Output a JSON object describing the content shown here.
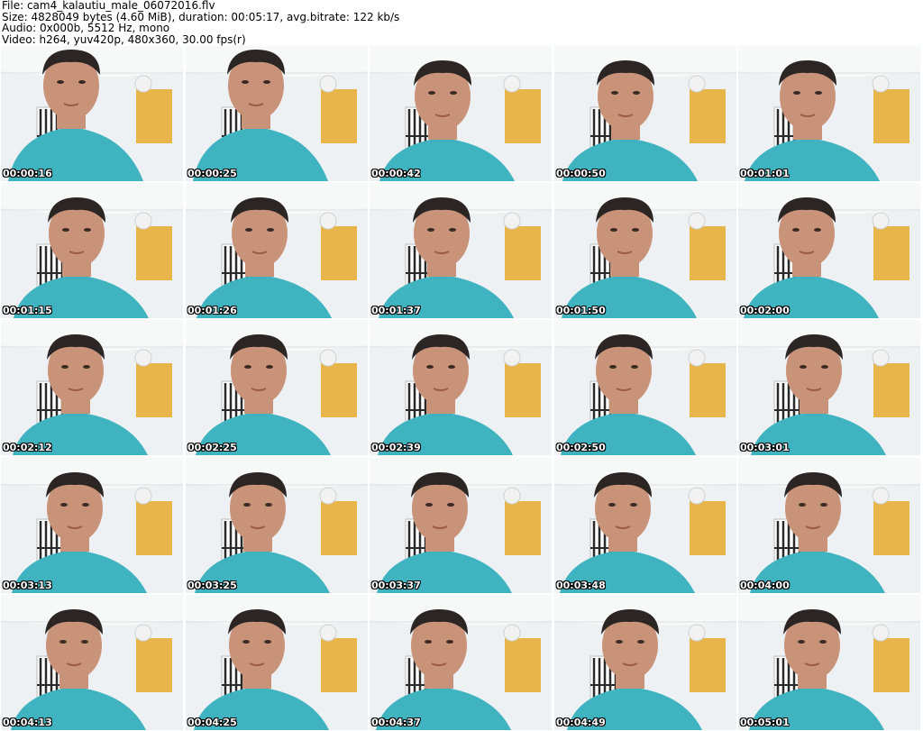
{
  "file_info": {
    "line1": "File: cam4_kalautiu_male_06072016.flv",
    "line2": "Size: 4828049 bytes (4.60 MiB), duration: 00:05:17, avg.bitrate: 122 kb/s",
    "line3": "Audio: 0x000b, 5512 Hz, mono",
    "line4": "Video: h264, yuv420p, 480x360, 30.00 fps(r)"
  },
  "colors": {
    "shirt": "#3fb3bf",
    "wall": "#eef1f3",
    "door": "#e8b54a",
    "skin": "#c9937a",
    "hair": "#2b2523"
  },
  "thumbnails": [
    {
      "timestamp": "00:00:16"
    },
    {
      "timestamp": "00:00:25"
    },
    {
      "timestamp": "00:00:42"
    },
    {
      "timestamp": "00:00:50"
    },
    {
      "timestamp": "00:01:01"
    },
    {
      "timestamp": "00:01:15"
    },
    {
      "timestamp": "00:01:26"
    },
    {
      "timestamp": "00:01:37"
    },
    {
      "timestamp": "00:01:50"
    },
    {
      "timestamp": "00:02:00"
    },
    {
      "timestamp": "00:02:12"
    },
    {
      "timestamp": "00:02:25"
    },
    {
      "timestamp": "00:02:39"
    },
    {
      "timestamp": "00:02:50"
    },
    {
      "timestamp": "00:03:01"
    },
    {
      "timestamp": "00:03:13"
    },
    {
      "timestamp": "00:03:25"
    },
    {
      "timestamp": "00:03:37"
    },
    {
      "timestamp": "00:03:48"
    },
    {
      "timestamp": "00:04:00"
    },
    {
      "timestamp": "00:04:13"
    },
    {
      "timestamp": "00:04:25"
    },
    {
      "timestamp": "00:04:37"
    },
    {
      "timestamp": "00:04:49"
    },
    {
      "timestamp": "00:05:01"
    }
  ]
}
